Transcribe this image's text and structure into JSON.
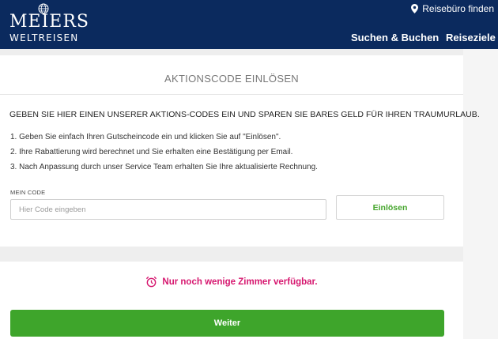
{
  "header": {
    "brand_main": "MEIERS",
    "brand_sub": "WELTREISEN",
    "agency_link": "Reisebüro finden",
    "nav": [
      "Suchen & Buchen",
      "Reiseziele"
    ]
  },
  "promo": {
    "title": "AKTIONSCODE EINLÖSEN",
    "intro": "GEBEN SIE HIER EINEN UNSERER AKTIONS-CODES EIN UND SPAREN SIE BARES GELD FÜR IHREN TRAUMURLAUB.",
    "steps": [
      "1. Geben Sie einfach Ihren Gutscheincode ein und klicken Sie auf \"Einlösen\".",
      "2. Ihre Rabattierung wird berechnet und Sie erhalten eine Bestätigung per Email.",
      "3. Nach Anpassung durch unser Service Team erhalten Sie Ihre aktualisierte Rechnung."
    ],
    "code_label": "MEIN CODE",
    "code_placeholder": "Hier Code eingeben",
    "code_value": "",
    "redeem_label": "Einlösen"
  },
  "availability": {
    "message": "Nur noch wenige Zimmer verfügbar."
  },
  "footer_action": {
    "continue_label": "Weiter"
  },
  "colors": {
    "header_bg": "#0b2a5e",
    "accent_green": "#3ea52b",
    "urgency_magenta": "#d6176f"
  },
  "icons": {
    "logo": "globe-icon",
    "agency": "location-pin-icon",
    "urgency": "alarm-clock-icon"
  }
}
